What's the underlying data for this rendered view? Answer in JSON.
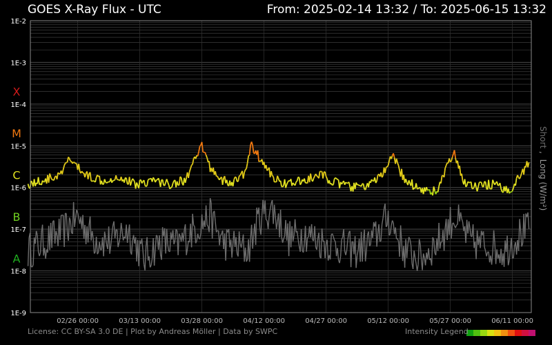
{
  "header": {
    "title": "GOES X-Ray Flux - UTC",
    "range": "From: 2025-02-14 13:32  /  To: 2025-06-15 13:32"
  },
  "footer": {
    "license": "License: CC BY-SA 3.0 DE | Plot by Andreas Möller | Data by SWPC",
    "legend_label": "Intensity Legend"
  },
  "colors": {
    "background": "#000000",
    "grid": "#4a4a4a",
    "short_series": "#6e6e6e",
    "label_X": "#d11a1a",
    "label_M": "#f07810",
    "label_C": "#e0e020",
    "label_B": "#70d020",
    "label_A": "#20b020",
    "legend": [
      "#10a010",
      "#50c010",
      "#98d810",
      "#d8e010",
      "#f0c010",
      "#f09010",
      "#f05010",
      "#e01010",
      "#d01040",
      "#c01070"
    ]
  },
  "chart_data": {
    "type": "line",
    "yscale": "log",
    "ylim": [
      1e-09,
      0.01
    ],
    "ylabel_short": "Short",
    "ylabel_sep": ",",
    "ylabel_long": "Long (W/m²)",
    "yticks": [
      {
        "value": 0.01,
        "label": "1E-2"
      },
      {
        "value": 0.001,
        "label": "1E-3"
      },
      {
        "value": 0.0001,
        "label": "1E-4"
      },
      {
        "value": 1e-05,
        "label": "1E-5"
      },
      {
        "value": 1e-06,
        "label": "1E-6"
      },
      {
        "value": 1e-07,
        "label": "1E-7"
      },
      {
        "value": 1e-08,
        "label": "1E-8"
      },
      {
        "value": 1e-09,
        "label": "1E-9"
      }
    ],
    "flare_classes": [
      {
        "label": "X",
        "value": 0.0002
      },
      {
        "label": "M",
        "value": 2e-05
      },
      {
        "label": "C",
        "value": 2e-06
      },
      {
        "label": "B",
        "value": 2e-07
      },
      {
        "label": "A",
        "value": 2e-08
      }
    ],
    "xlim": [
      "2025-02-14 13:32",
      "2025-06-15 13:32"
    ],
    "xticks": [
      "02/26 00:00",
      "03/13 00:00",
      "03/28 00:00",
      "04/12 00:00",
      "04/27 00:00",
      "05/12 00:00",
      "05/27 00:00",
      "06/11 00:00"
    ],
    "grid": true,
    "series": [
      {
        "name": "Long",
        "x": [
          "2025-02-14",
          "2025-02-18",
          "2025-02-22",
          "2025-02-24",
          "2025-02-26",
          "2025-02-28",
          "2025-03-04",
          "2025-03-08",
          "2025-03-12",
          "2025-03-16",
          "2025-03-20",
          "2025-03-24",
          "2025-03-27",
          "2025-03-28",
          "2025-03-30",
          "2025-04-02",
          "2025-04-04",
          "2025-04-07",
          "2025-04-09",
          "2025-04-11",
          "2025-04-13",
          "2025-04-15",
          "2025-04-18",
          "2025-04-22",
          "2025-04-26",
          "2025-04-30",
          "2025-05-04",
          "2025-05-08",
          "2025-05-12",
          "2025-05-13",
          "2025-05-16",
          "2025-05-20",
          "2025-05-24",
          "2025-05-26",
          "2025-05-28",
          "2025-05-30",
          "2025-06-02",
          "2025-06-06",
          "2025-06-10",
          "2025-06-13",
          "2025-06-15"
        ],
        "y": [
          1.2e-06,
          1.5e-06,
          2e-06,
          5e-06,
          3e-06,
          2e-06,
          1.5e-06,
          1.8e-06,
          1.2e-06,
          1.5e-06,
          1.2e-06,
          1.5e-06,
          6e-06,
          1e-05,
          3e-06,
          1.5e-06,
          1.2e-06,
          2e-06,
          1e-05,
          5e-06,
          2.5e-06,
          1.5e-06,
          1.2e-06,
          1.5e-06,
          2e-06,
          1.2e-06,
          1e-06,
          1.2e-06,
          3e-06,
          6e-06,
          1.5e-06,
          9e-07,
          8e-07,
          3e-06,
          6e-06,
          1.5e-06,
          1e-06,
          1.2e-06,
          8e-07,
          2e-06,
          4e-06
        ]
      },
      {
        "name": "Short",
        "x": [
          "2025-02-14",
          "2025-02-18",
          "2025-02-22",
          "2025-02-26",
          "2025-03-02",
          "2025-03-06",
          "2025-03-10",
          "2025-03-14",
          "2025-03-18",
          "2025-03-22",
          "2025-03-26",
          "2025-03-30",
          "2025-04-02",
          "2025-04-05",
          "2025-04-08",
          "2025-04-11",
          "2025-04-14",
          "2025-04-18",
          "2025-04-22",
          "2025-04-26",
          "2025-04-30",
          "2025-05-04",
          "2025-05-08",
          "2025-05-12",
          "2025-05-16",
          "2025-05-20",
          "2025-05-24",
          "2025-05-28",
          "2025-06-01",
          "2025-06-05",
          "2025-06-09",
          "2025-06-13",
          "2025-06-15"
        ],
        "y": [
          3e-08,
          5e-08,
          8e-08,
          2e-07,
          6e-08,
          5e-08,
          1e-07,
          2e-08,
          5e-08,
          4e-08,
          1e-07,
          2e-07,
          5e-08,
          4e-08,
          3e-08,
          2e-07,
          3e-07,
          6e-08,
          8e-08,
          5e-08,
          4e-08,
          3e-08,
          5e-08,
          2e-07,
          3e-08,
          2e-08,
          5e-08,
          2e-07,
          5e-08,
          4e-08,
          3e-08,
          8e-08,
          1e-07
        ]
      }
    ]
  }
}
